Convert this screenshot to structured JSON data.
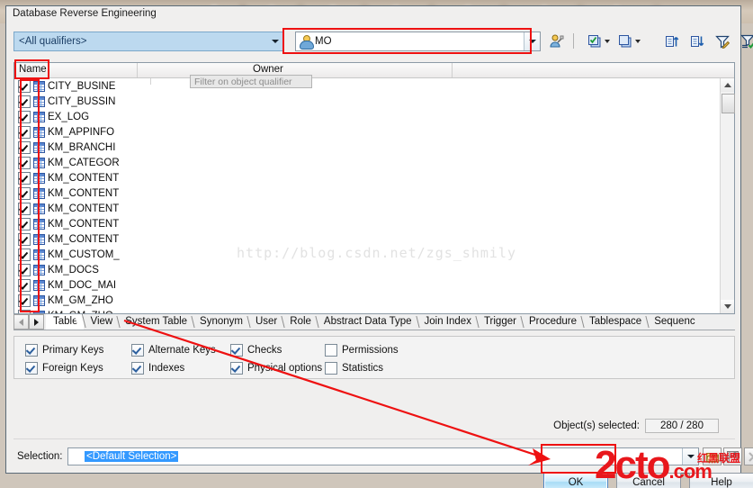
{
  "window": {
    "title": "Database Reverse Engineering"
  },
  "filter_bar": {
    "qualifier_combo": {
      "value": "<All qualifiers>",
      "tooltip": "Filter on object qualifier"
    },
    "owner_combo": {
      "value": "MO",
      "icon": "user-icon"
    },
    "buttons": [
      {
        "name": "select-owner-button",
        "icon": "user-filter-icon"
      },
      {
        "name": "select-all-button",
        "icon": "select-all-icon"
      },
      {
        "name": "deselect-all-button",
        "icon": "deselect-all-icon"
      },
      {
        "name": "sort-ascending-button",
        "icon": "sort-ascending-icon"
      },
      {
        "name": "sort-descending-button",
        "icon": "sort-descending-icon"
      },
      {
        "name": "edit-filter-button",
        "icon": "filter-edit-icon"
      },
      {
        "name": "apply-filter-button",
        "icon": "filter-apply-icon"
      }
    ]
  },
  "list": {
    "columns": [
      "Name",
      "Owner",
      ""
    ],
    "rows": [
      {
        "name": "CITY_BUSINE",
        "checked": true
      },
      {
        "name": "CITY_BUSSIN",
        "checked": true
      },
      {
        "name": "EX_LOG",
        "checked": true
      },
      {
        "name": "KM_APPINFO",
        "checked": true
      },
      {
        "name": "KM_BRANCHI",
        "checked": true
      },
      {
        "name": "KM_CATEGOR",
        "checked": true
      },
      {
        "name": "KM_CONTENT",
        "checked": true
      },
      {
        "name": "KM_CONTENT",
        "checked": true
      },
      {
        "name": "KM_CONTENT",
        "checked": true
      },
      {
        "name": "KM_CONTENT",
        "checked": true
      },
      {
        "name": "KM_CONTENT",
        "checked": true
      },
      {
        "name": "KM_CUSTOM_",
        "checked": true
      },
      {
        "name": "KM_DOCS",
        "checked": true
      },
      {
        "name": "KM_DOC_MAI",
        "checked": true
      },
      {
        "name": "KM_GM_ZHO",
        "checked": true
      },
      {
        "name": "KM_GM_ZHO",
        "checked": true
      }
    ]
  },
  "tabs": {
    "prev_label": "◀",
    "next_label": "▶",
    "items": [
      "Table",
      "View",
      "System Table",
      "Synonym",
      "User",
      "Role",
      "Abstract Data Type",
      "Join Index",
      "Trigger",
      "Procedure",
      "Tablespace",
      "Sequenc"
    ],
    "selected": "Table"
  },
  "options": [
    {
      "label": "Primary Keys",
      "checked": true
    },
    {
      "label": "Alternate Keys",
      "checked": true
    },
    {
      "label": "Checks",
      "checked": true
    },
    {
      "label": "Permissions",
      "checked": false
    },
    {
      "label": "Foreign Keys",
      "checked": true
    },
    {
      "label": "Indexes",
      "checked": true
    },
    {
      "label": "Physical options",
      "checked": true
    },
    {
      "label": "Statistics",
      "checked": false
    }
  ],
  "status": {
    "objects_selected_label": "Object(s) selected:",
    "objects_selected_value": "280 / 280"
  },
  "selection": {
    "label": "Selection:",
    "value": "<Default Selection>",
    "buttons": [
      {
        "name": "open-selection-button",
        "icon": "folder-icon"
      },
      {
        "name": "save-selection-button",
        "icon": "save-icon"
      },
      {
        "name": "delete-selection-button",
        "icon": "close-x-icon"
      }
    ]
  },
  "footer": {
    "ok_label": "OK",
    "cancel_label": "Cancel",
    "help_label": "Help"
  },
  "watermarks": {
    "center": "http://blog.csdn.net/zgs_shmily",
    "brand": "2cto",
    "brand_tld": ".com",
    "brand_cn": "红黑联盟"
  },
  "colors": {
    "accent": "#3399ff",
    "annotation": "#ee1111",
    "qualifier_bg": "#bcd9ef",
    "watermark_red": "#e8171c"
  }
}
